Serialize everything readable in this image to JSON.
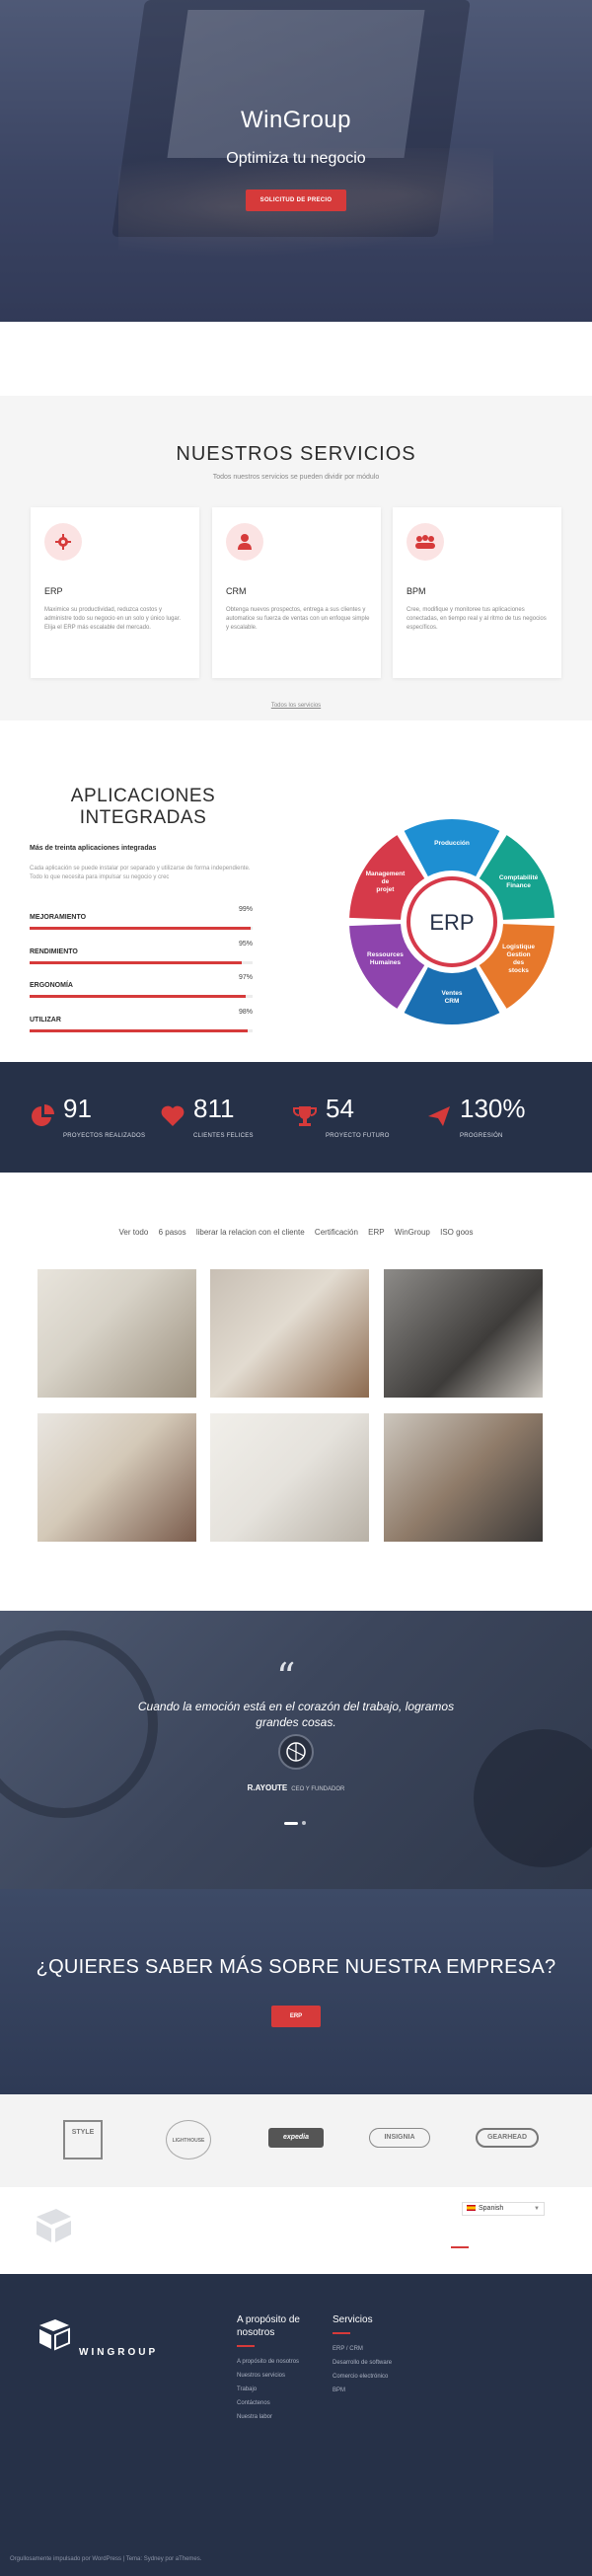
{
  "hero": {
    "title": "WinGroup",
    "subtitle": "Optimiza tu negocio",
    "cta": "SOLICITUD DE PRECIO"
  },
  "services": {
    "title": "NUESTROS SERVICIOS",
    "description": "Todos nuestros servicios se pueden dividir por módulo",
    "cards": [
      {
        "title": "ERP",
        "icon": "gear-icon",
        "text": "Maximice su productividad, reduzca costos y administre todo su negocio en un solo y único lugar. Elija el ERP más escalable del mercado."
      },
      {
        "title": "CRM",
        "icon": "user-icon",
        "text": "Obtenga nuevos prospectos, entrega a sus clientes y automatice su fuerza de ventas con un enfoque simple y escalable."
      },
      {
        "title": "BPM",
        "icon": "team-icon",
        "text": "Cree, modifique y monitoree tus aplicaciones conectadas, en tiempo real y al ritmo de tus negocios específicos."
      }
    ],
    "more_link": "Todos los servicios"
  },
  "apps": {
    "title": "APLICACIONES INTEGRADAS",
    "lead": "Más de treinta aplicaciones integradas",
    "paragraph": "Cada aplicación se puede instalar por separado y utilizarse de forma independiente. Todo lo que necesita para impulsar su negocio y crec",
    "bars": [
      {
        "label": "MEJORAMIENTO",
        "value": 99,
        "display": "99%"
      },
      {
        "label": "RENDIMIENTO",
        "value": 95,
        "display": "95%"
      },
      {
        "label": "ERGONOMÍA",
        "value": 97,
        "display": "97%"
      },
      {
        "label": "UTILIZAR",
        "value": 98,
        "display": "98%"
      }
    ],
    "wheel": {
      "center": "ERP",
      "segments": [
        "Producción",
        "Comptabilité Finance",
        "Logistique Gestion des stocks",
        "Ventes CRM",
        "Ressources Humaines",
        "Management de projet"
      ],
      "colors": [
        "#1e8fd2",
        "#16a38f",
        "#e7782b",
        "#1a6fb2",
        "#8e44ad",
        "#d63a4a"
      ]
    }
  },
  "stats": [
    {
      "number": "91",
      "label": "PROYECTOS REALIZADOS",
      "icon": "pie-chart-icon"
    },
    {
      "number": "811",
      "label": "CLIENTES FELICES",
      "icon": "heart-icon"
    },
    {
      "number": "54",
      "label": "PROYECTO FUTURO",
      "icon": "trophy-icon"
    },
    {
      "number": "130%",
      "label": "PROGRESIÓN",
      "icon": "paper-plane-icon"
    }
  ],
  "portfolio": {
    "filters": [
      "Ver todo",
      "6 pasos",
      "liberar la relacion con el cliente",
      "Certificación",
      "ERP",
      "WinGroup",
      "ISO goos"
    ]
  },
  "testimonial": {
    "quote": "Cuando la emoción está en el corazón del trabajo, logramos grandes cosas.",
    "name": "R.AYOUTE",
    "role": "CEO Y FUNDADOR"
  },
  "cta": {
    "title": "¿QUIERES SABER MÁS SOBRE NUESTRA EMPRESA?",
    "button": "ERP"
  },
  "logos": [
    "STYLE",
    "LIGHTHOUSE",
    "expedia",
    "INSIGNIA",
    "GEARHEAD"
  ],
  "language": {
    "selected": "Spanish"
  },
  "footer": {
    "brand": "WINGROUP",
    "col1": {
      "title": "A propósito de nosotros",
      "links": [
        "A propósito de nosotros",
        "Nuestros servicios",
        "Trabajo",
        "Contáctenos",
        "Nuestra labor"
      ]
    },
    "col2": {
      "title": "Servicios",
      "links": [
        "ERP / CRM",
        "Desarrollo de software",
        "Comercio electrónico",
        "BPM"
      ]
    },
    "copyright": "Orgullosamente impulsado por WordPress | Tema: Sydney por aThemes."
  },
  "colors": {
    "accent": "#d63a3a",
    "navy": "#263148"
  }
}
